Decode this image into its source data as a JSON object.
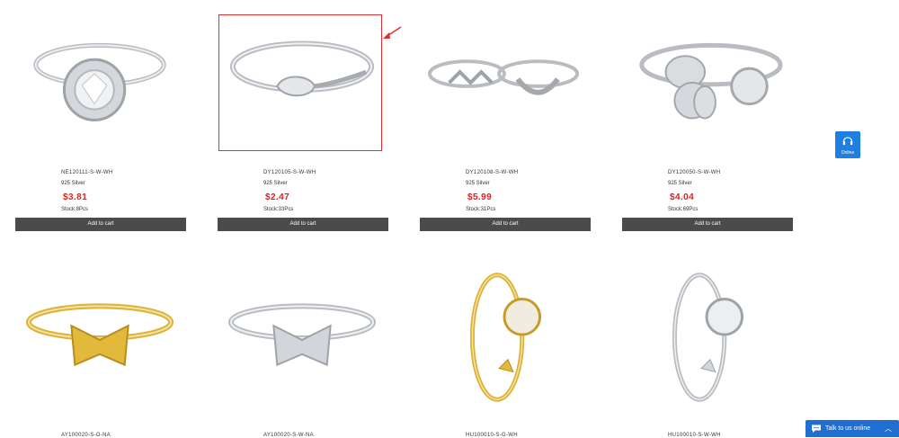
{
  "products": [
    {
      "sku": "NE120111-S-W-WH",
      "material": "925 Silver",
      "price": "$3.81",
      "stock": "Stock:8Pcs",
      "cart": "Add to cart"
    },
    {
      "sku": "DY120105-S-W-WH",
      "material": "925 Silver",
      "price": "$2.47",
      "stock": "Stock:33Pcs",
      "cart": "Add to cart"
    },
    {
      "sku": "DY120108-S-W-WH",
      "material": "925 Silver",
      "price": "$5.99",
      "stock": "Stock:31Pcs",
      "cart": "Add to cart"
    },
    {
      "sku": "DY120050-S-W-WH",
      "material": "925 Silver",
      "price": "$4.04",
      "stock": "Stock:69Pcs",
      "cart": "Add to cart"
    },
    {
      "sku": "AY100020-S-G-NA"
    },
    {
      "sku": "AY100020-S-W-NA"
    },
    {
      "sku": "HU100010-S-G-WH"
    },
    {
      "sku": "HU100010-S-W-WH"
    }
  ],
  "online_widget": {
    "label": "Online"
  },
  "chat_bar": {
    "label": "Talk to us online"
  },
  "colors": {
    "price": "#e02020",
    "button": "#4b4b4b",
    "accent": "#1e7fe0",
    "highlight": "#e03030",
    "gold": "#e2b93b",
    "silver": "#c9ccd0"
  }
}
